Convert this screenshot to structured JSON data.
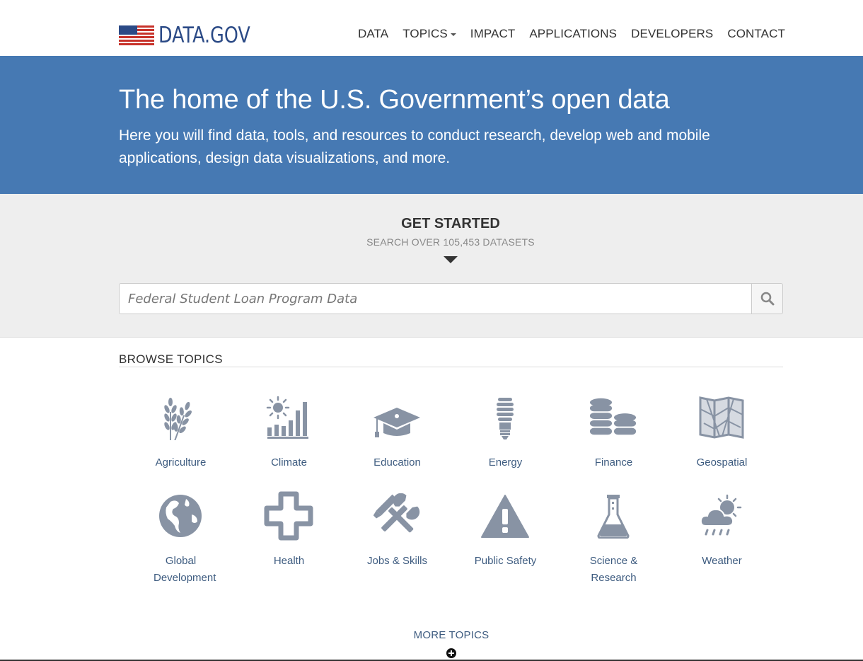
{
  "site": {
    "logo_text": "DATA.GOV",
    "logo_alt": "Data.gov flag logo"
  },
  "nav": {
    "items": [
      "DATA",
      "TOPICS",
      "IMPACT",
      "APPLICATIONS",
      "DEVELOPERS",
      "CONTACT"
    ]
  },
  "hero": {
    "title": "The home of the U.S. Government’s open data",
    "subtitle": "Here you will find data, tools, and resources to conduct research, develop web and mobile applications, design data visualizations, and more."
  },
  "get_started": {
    "title": "GET STARTED",
    "subtitle": "SEARCH OVER 105,453 DATASETS",
    "search_placeholder": "Federal Student Loan Program Data"
  },
  "browse": {
    "title": "BROWSE TOPICS",
    "topics": [
      {
        "label": "Agriculture",
        "icon": "wheat-icon"
      },
      {
        "label": "Climate",
        "icon": "sun-chart-icon"
      },
      {
        "label": "Education",
        "icon": "graduation-cap-icon"
      },
      {
        "label": "Energy",
        "icon": "lightbulb-icon"
      },
      {
        "label": "Finance",
        "icon": "coins-icon"
      },
      {
        "label": "Geospatial",
        "icon": "map-icon"
      },
      {
        "label": "Global Development",
        "icon": "globe-icon"
      },
      {
        "label": "Health",
        "icon": "health-cross-icon"
      },
      {
        "label": "Jobs & Skills",
        "icon": "tools-icon"
      },
      {
        "label": "Public Safety",
        "icon": "warning-icon"
      },
      {
        "label": "Science & Research",
        "icon": "flask-icon"
      },
      {
        "label": "Weather",
        "icon": "weather-icon"
      }
    ],
    "more_label": "MORE TOPICS"
  },
  "colors": {
    "hero_bg": "#4679b3",
    "icon": "#8893a4",
    "link": "#3e5c80",
    "logo": "#2b4a86"
  }
}
